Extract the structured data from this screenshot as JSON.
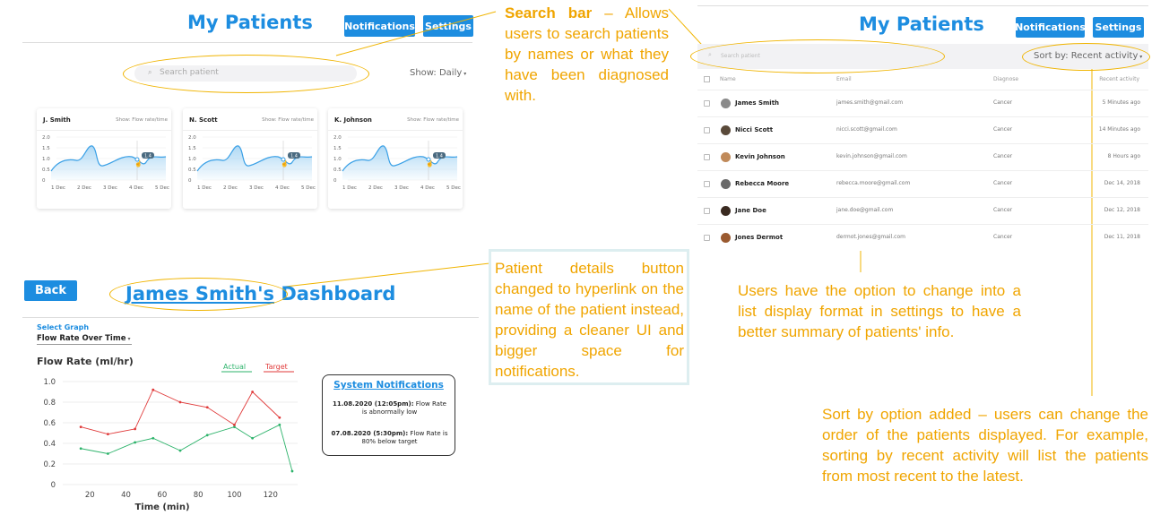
{
  "panel1": {
    "title": "My Patients",
    "notifications_label": "Notifications",
    "settings_label": "Settings",
    "search_placeholder": "Search patient",
    "show_filter": "Show: Daily",
    "cards": [
      {
        "name": "J. Smith",
        "show": "Show: Flow rate/time"
      },
      {
        "name": "N. Scott",
        "show": "Show: Flow rate/time"
      },
      {
        "name": "K. Johnson",
        "show": "Show: Flow rate/time"
      }
    ],
    "mini_chart": {
      "y_ticks": [
        "2.0",
        "1.5",
        "1.0",
        "0.5",
        "0"
      ],
      "x_ticks": [
        "1 Dec",
        "2 Dec",
        "3 Dec",
        "4 Dec",
        "5 Dec"
      ],
      "tooltip": "1.4"
    }
  },
  "callout_search": {
    "bold": "Search bar",
    "rest": " – Allows users to search patients by names or what they have been diagnosed with."
  },
  "panel2": {
    "title": "My Patients",
    "notifications_label": "Notifications",
    "settings_label": "Settings",
    "search_placeholder": "Search patient",
    "sort_label": "Sort by: Recent activity",
    "headers": {
      "name": "Name",
      "email": "Email",
      "diagnose": "Diagnose",
      "recent": "Recent activity"
    },
    "rows": [
      {
        "name": "James Smith",
        "email": "james.smith@gmail.com",
        "diagnose": "Cancer",
        "recent": "5 Minutes ago",
        "avatar_color": "#8a8a8a"
      },
      {
        "name": "Nicci Scott",
        "email": "nicci.scott@gmail.com",
        "diagnose": "Cancer",
        "recent": "14 Minutes ago",
        "avatar_color": "#5a4a3a"
      },
      {
        "name": "Kevin Johnson",
        "email": "kevin.johnson@gmail.com",
        "diagnose": "Cancer",
        "recent": "8 Hours ago",
        "avatar_color": "#c08a5a"
      },
      {
        "name": "Rebecca Moore",
        "email": "rebecca.moore@gmail.com",
        "diagnose": "Cancer",
        "recent": "Dec 14, 2018",
        "avatar_color": "#6a6a6a"
      },
      {
        "name": "Jane Doe",
        "email": "jane.doe@gmail.com",
        "diagnose": "Cancer",
        "recent": "Dec 12, 2018",
        "avatar_color": "#3a2a20"
      },
      {
        "name": "Jones Dermot",
        "email": "dermot.jones@gmail.com",
        "diagnose": "Cancer",
        "recent": "Dec 11, 2018",
        "avatar_color": "#9a5a30"
      }
    ]
  },
  "callout_list": "Users have the option to change into a list display format in settings to have a better summary of patients' info.",
  "callout_sort": "Sort by option added – users can change the order of the patients displayed. For example, sorting by recent activity will list the patients from most recent to the latest.",
  "panel3": {
    "back_label": "Back",
    "title_link": "James Smith's",
    "title_rest": " Dashboard",
    "select_graph_label": "Select Graph",
    "graph_selected": "Flow Rate Over Time",
    "notifications_title": "System Notifications",
    "notifications": [
      {
        "when": "11.08.2020 (12:05pm):",
        "text": "Flow Rate is abnormally low"
      },
      {
        "when": "07.08.2020 (5:30pm):",
        "text": "Flow Rate is 80% below target"
      }
    ]
  },
  "callout_details": "Patient details button changed to hyperlink on the name of the patient instead, providing a cleaner UI and bigger space for notifications.",
  "chart_data": {
    "type": "line",
    "title": "",
    "ylabel": "Flow Rate (ml/hr)",
    "xlabel": "Time (min)",
    "x": [
      15,
      30,
      45,
      55,
      70,
      85,
      100,
      110,
      125
    ],
    "series": [
      {
        "name": "Actual",
        "color": "#2db36b",
        "values": [
          0.35,
          0.3,
          0.41,
          0.45,
          0.33,
          0.48,
          0.56,
          0.45,
          0.58
        ]
      },
      {
        "name": "Target",
        "color": "#e03a3a",
        "values": [
          0.56,
          0.49,
          0.54,
          0.92,
          0.8,
          0.75,
          0.58,
          0.9,
          0.65
        ]
      }
    ],
    "trailing_actual": {
      "x": 132,
      "y": 0.13
    },
    "trailing_target": {
      "x": 125,
      "y": 0.65
    },
    "xlim": [
      5,
      135
    ],
    "ylim": [
      0,
      1.0
    ],
    "x_ticks": [
      20,
      40,
      60,
      80,
      100,
      120
    ],
    "y_ticks": [
      "0",
      "0.2",
      "0.4",
      "0.6",
      "0.8",
      "1.0"
    ],
    "legend": "top-right",
    "grid": true
  }
}
